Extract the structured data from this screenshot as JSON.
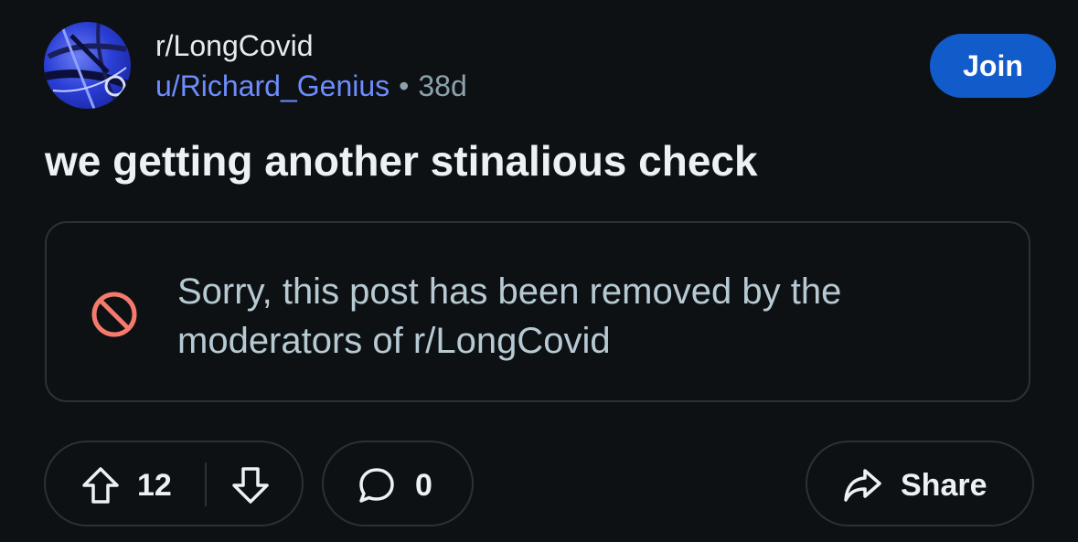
{
  "post": {
    "subreddit": "r/LongCovid",
    "username": "u/Richard_Genius",
    "separator": "•",
    "age": "38d",
    "join_label": "Join",
    "title": "we getting another stinalious check",
    "removed_notice": "Sorry, this post has been removed by the moderators of r/LongCovid"
  },
  "actions": {
    "upvote_icon": "arrow-up-icon",
    "vote_count": "12",
    "downvote_icon": "arrow-down-icon",
    "comment_icon": "speech-bubble-icon",
    "comment_count": "0",
    "share_icon": "share-arrow-icon",
    "share_label": "Share"
  },
  "colors": {
    "background": "#0e1113",
    "join_button": "#115bca",
    "username": "#6d8cff",
    "removed_icon": "#f57a6c",
    "border": "#2a3236"
  }
}
